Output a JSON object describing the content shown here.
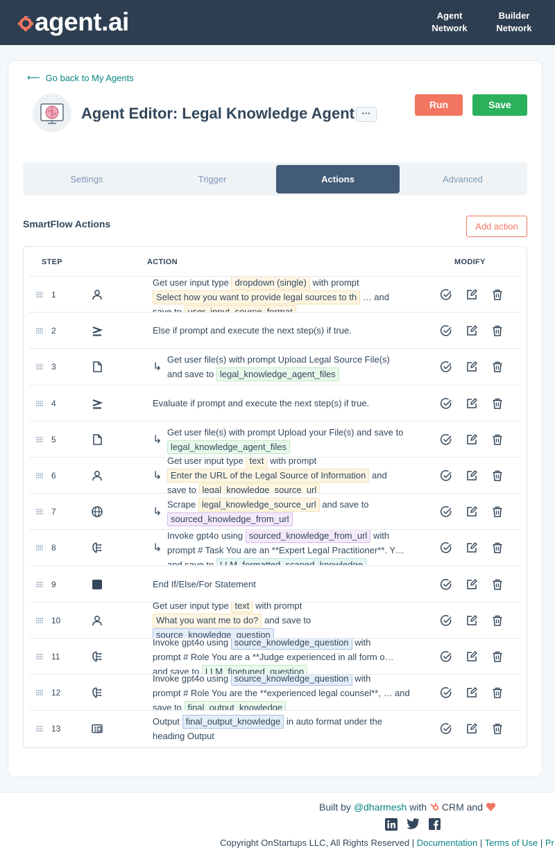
{
  "header": {
    "logo_text": "agent.ai",
    "nav": [
      {
        "line1": "Agent",
        "line2": "Network"
      },
      {
        "line1": "Builder",
        "line2": "Network"
      }
    ]
  },
  "editor": {
    "back_label": "Go back to My Agents",
    "title": "Agent Editor: Legal Knowledge Agent",
    "more_label": "···",
    "run_label": "Run",
    "save_label": "Save"
  },
  "tabs": [
    "Settings",
    "Trigger",
    "Actions",
    "Advanced"
  ],
  "active_tab": "Actions",
  "actions_section": {
    "title": "SmartFlow Actions",
    "add_label": "Add action",
    "columns": {
      "step": "STEP",
      "action": "ACTION",
      "modify": "MODIFY"
    }
  },
  "steps": [
    {
      "n": "1",
      "icon": "user-icon"
    },
    {
      "n": "2",
      "icon": "condition-icon"
    },
    {
      "n": "3",
      "icon": "file-icon"
    },
    {
      "n": "4",
      "icon": "condition-icon"
    },
    {
      "n": "5",
      "icon": "file-icon"
    },
    {
      "n": "6",
      "icon": "user-icon"
    },
    {
      "n": "7",
      "icon": "globe-icon"
    },
    {
      "n": "8",
      "icon": "ai-brain-icon"
    },
    {
      "n": "9",
      "icon": "stop-icon"
    },
    {
      "n": "10",
      "icon": "user-icon"
    },
    {
      "n": "11",
      "icon": "ai-brain-icon"
    },
    {
      "n": "12",
      "icon": "ai-brain-icon"
    },
    {
      "n": "13",
      "icon": "output-icon"
    }
  ],
  "step_text": {
    "s1": {
      "a": "Get user input type",
      "chip1": "dropdown (single)",
      "b": "with prompt",
      "chip2": "Select how you want to provide legal sources to th",
      "c": "… and",
      "d": "save to",
      "chip3": "user_input_source_format"
    },
    "s2": {
      "a": "Else if prompt and execute the next step(s) if true."
    },
    "s3": {
      "a": "Get user file(s) with prompt Upload Legal Source File(s)",
      "b": "and save to",
      "chip1": "legal_knowledge_agent_files"
    },
    "s4": {
      "a": "Evaluate if prompt and execute the next step(s) if true."
    },
    "s5": {
      "a": "Get user file(s) with prompt Upload your File(s) and save to",
      "chip1": "legal_knowledge_agent_files"
    },
    "s6": {
      "a": "Get user input type",
      "chip1": "text",
      "b": "with prompt",
      "chip2": "Enter the URL of the Legal Source of Information",
      "c": "and",
      "d": "save to",
      "chip3": "legal_knowledge_source_url"
    },
    "s7": {
      "a": "Scrape",
      "chip1": "legal_knowledge_source_url",
      "b": "and save to",
      "chip2": "sourced_knowledge_from_url"
    },
    "s8": {
      "a": "Invoke gpt4o using",
      "chip1": "sourced_knowledge_from_url",
      "b": "with",
      "c": "prompt # Task You are an **Expert Legal Practitioner**. Y…",
      "d": "and save to",
      "chip2": "LLM_formatted_scaped_knowledge"
    },
    "s9": {
      "a": "End If/Else/For Statement"
    },
    "s10": {
      "a": "Get user input type",
      "chip1": "text",
      "b": "with prompt",
      "chip2": "What you want me to do?",
      "c": "and save to",
      "chip3": "source_knowledge_question"
    },
    "s11": {
      "a": "Invoke gpt4o using",
      "chip1": "source_knowledge_question",
      "b": "with",
      "c": "prompt # Role You are a **Judge experienced in all form o…",
      "d": "and save to",
      "chip2": "LLM_finetuned_question"
    },
    "s12": {
      "a": "Invoke gpt4o using",
      "chip1": "source_knowledge_question",
      "b": "with",
      "c": "prompt # Role You are the **experienced legal counsel**, … and",
      "d": "save to",
      "chip2": "final_output_knowledge"
    },
    "s13": {
      "a": "Output",
      "chip1": "final_output_knowledge",
      "b": "in auto format under the",
      "c": "heading Output"
    }
  },
  "footer": {
    "built_by": "Built by",
    "handle": "@dharmesh",
    "with": "with",
    "crm": "CRM and",
    "copyright": "Copyright OnStartups LLC, All Rights Reserved |",
    "documentation": "Documentation",
    "sep": "|",
    "terms": "Terms of Use",
    "sep2": "|",
    "privacy_cut": "Pr"
  },
  "colors": {
    "header_bg": "#2d3e50",
    "run": "#f27560",
    "save": "#2bb15c",
    "active_tab": "#425b76",
    "link": "#0b8484"
  }
}
